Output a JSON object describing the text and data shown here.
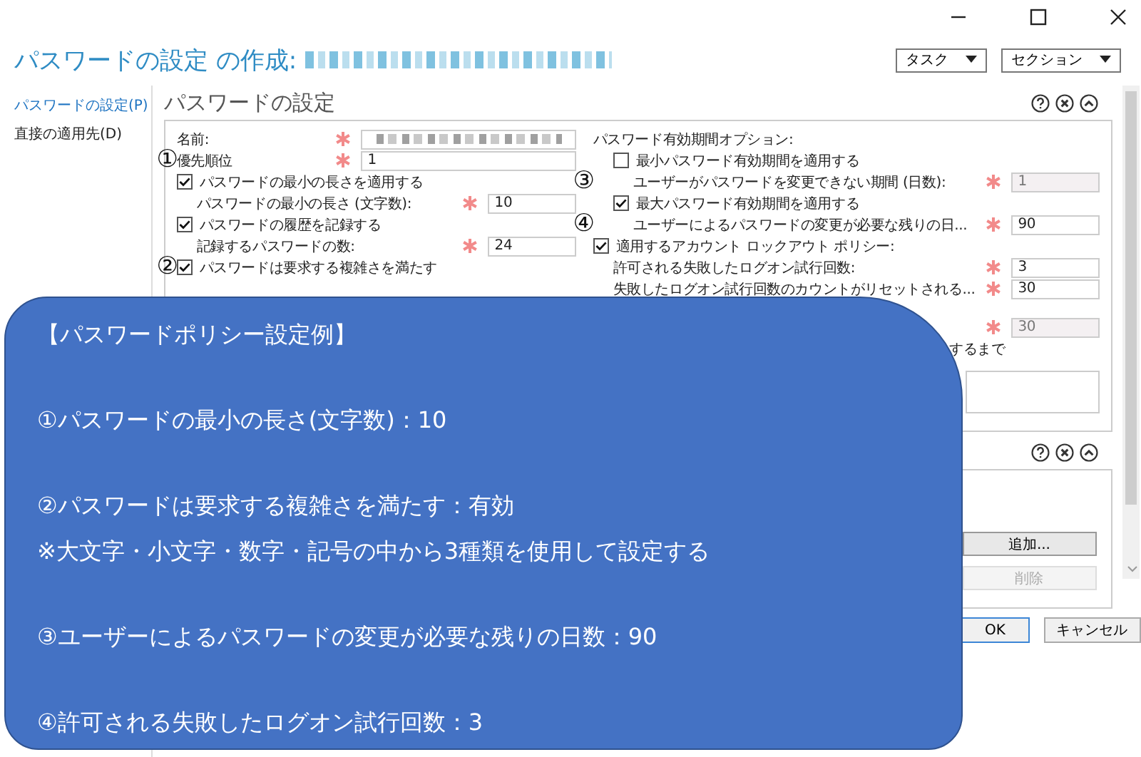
{
  "window": {
    "title": "パスワードの設定 の作成:",
    "title_blurred": true
  },
  "header_buttons": [
    {
      "label": "タスク"
    },
    {
      "label": "セクション"
    }
  ],
  "sidebar": {
    "items": [
      {
        "label": "パスワードの設定(P)",
        "selected": true
      },
      {
        "label": "直接の適用先(D)",
        "selected": false
      }
    ]
  },
  "section": {
    "title": "パスワードの設定",
    "left": [
      {
        "kind": "field",
        "label": "名前:",
        "required": true,
        "blurred": true
      },
      {
        "kind": "field",
        "label": "優先順位",
        "required": true,
        "value": "1",
        "marker": "①"
      },
      {
        "kind": "checkbox",
        "label": "パスワードの最小の長さを適用する",
        "checked": true,
        "children": [
          {
            "kind": "field",
            "label": "パスワードの最小の長さ (文字数):",
            "required": true,
            "value": "10"
          }
        ]
      },
      {
        "kind": "checkbox",
        "label": "パスワードの履歴を記録する",
        "checked": true,
        "children": [
          {
            "kind": "field",
            "label": "記録するパスワードの数:",
            "required": true,
            "value": "24"
          }
        ]
      },
      {
        "kind": "checkbox",
        "label": "パスワードは要求する複雑さを満たす",
        "checked": true,
        "marker": "②"
      }
    ],
    "right": [
      {
        "kind": "heading",
        "label": "パスワード有効期間オプション:"
      },
      {
        "kind": "checkbox",
        "label": "最小パスワード有効期間を適用する",
        "checked": false,
        "indent": true,
        "children": [
          {
            "kind": "field",
            "label": "ユーザーがパスワードを変更できない期間 (日数):",
            "required": true,
            "value": "1",
            "disabled": true,
            "marker": "③"
          }
        ]
      },
      {
        "kind": "checkbox",
        "label": "最大パスワード有効期間を適用する",
        "checked": true,
        "indent": true,
        "children": [
          {
            "kind": "field",
            "label": "ユーザーによるパスワードの変更が必要な残りの日...",
            "required": true,
            "value": "90",
            "marker": "④"
          }
        ]
      },
      {
        "kind": "checkbox",
        "label": "適用するアカウント ロックアウト ポリシー:",
        "checked": true,
        "children": [
          {
            "kind": "field",
            "label": "許可される失敗したログオン試行回数:",
            "required": true,
            "value": "3"
          },
          {
            "kind": "field",
            "label": "失敗したログオン試行回数のカウントがリセットされる...",
            "required": true,
            "value": "30"
          }
        ]
      },
      {
        "kind": "field",
        "required": true,
        "value": "30",
        "disabled": true
      },
      {
        "kind": "note",
        "label": "するまで"
      },
      {
        "kind": "textarea"
      }
    ]
  },
  "section2": {
    "buttons": [
      {
        "label": "追加...",
        "disabled": false
      },
      {
        "label": "削除",
        "disabled": true
      }
    ]
  },
  "footer_buttons": [
    {
      "label": "OK",
      "focused": true
    },
    {
      "label": "キャンセル",
      "focused": false
    }
  ],
  "callout": {
    "paragraphs": [
      [
        "【パスワードポリシー設定例】"
      ],
      [
        "①パスワードの最小の長さ(文字数)：10"
      ],
      [
        "②パスワードは要求する複雑さを満たす：有効",
        "※大文字・小文字・数字・記号の中から3種類を使用して設定する"
      ],
      [
        "③ユーザーによるパスワードの変更が必要な残りの日数：90"
      ],
      [
        "④許可される失敗したログオン試行回数：3"
      ]
    ]
  }
}
